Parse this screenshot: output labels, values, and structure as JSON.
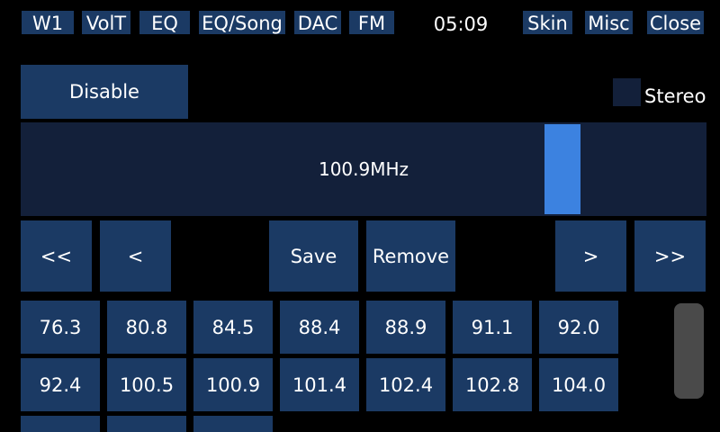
{
  "topbar": {
    "buttons": [
      "W1",
      "VolT",
      "EQ",
      "EQ/Song",
      "DAC",
      "FM"
    ],
    "clock": "05:09",
    "right_buttons": [
      "Skin",
      "Misc",
      "Close"
    ]
  },
  "fm": {
    "disable_label": "Disable",
    "stereo_label": "Stereo",
    "frequency": "100.9MHz",
    "tuner_position": 0.79
  },
  "controls": {
    "seek_back_far": "<<",
    "seek_back": "<",
    "save": "Save",
    "remove": "Remove",
    "seek_forward": ">",
    "seek_forward_far": ">>"
  },
  "presets": [
    "76.3",
    "80.8",
    "84.5",
    "88.4",
    "88.9",
    "91.1",
    "92.0",
    "92.4",
    "100.5",
    "100.9",
    "101.4",
    "102.4",
    "102.8",
    "104.0",
    "",
    "",
    ""
  ],
  "colors": {
    "button": "#1b3a64",
    "panel": "#13203a",
    "accent": "#3c82e0",
    "background": "#000000",
    "scrollbar": "#4a4a4a"
  }
}
